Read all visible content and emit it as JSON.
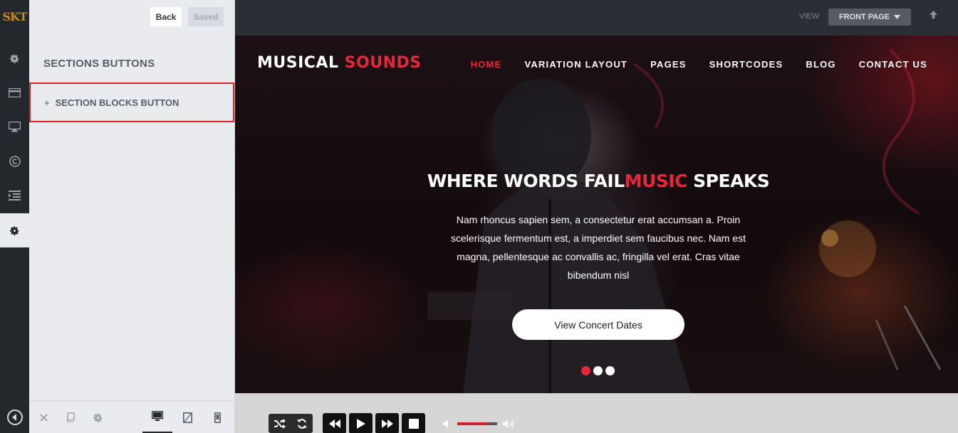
{
  "rail": {
    "logo": "SKT",
    "items": [
      {
        "name": "settings",
        "icon": "gear-icon"
      },
      {
        "name": "card",
        "icon": "credit-card-icon"
      },
      {
        "name": "monitor",
        "icon": "monitor-icon"
      },
      {
        "name": "copyright",
        "icon": "copyright-icon"
      },
      {
        "name": "menu",
        "icon": "indent-list-icon"
      },
      {
        "name": "active-settings",
        "icon": "gear-icon"
      }
    ],
    "collapse_icon": "collapse-left-icon"
  },
  "panel": {
    "back_label": "Back",
    "saved_label": "Saved",
    "title": "SECTIONS BUTTONS",
    "section_item": {
      "prefix": "+",
      "label": "SECTION BLOCKS BUTTON"
    },
    "footer_icons": [
      "close-icon",
      "book-icon",
      "gear-icon"
    ],
    "devices": [
      "desktop-icon",
      "tablet-icon",
      "mobile-icon"
    ],
    "active_device": "desktop"
  },
  "topbar": {
    "view_label": "VIEW",
    "view_value": "FRONT PAGE",
    "up_icon": "arrow-up-icon"
  },
  "site": {
    "logo_primary": "MUSICAL",
    "logo_accent": "SOUNDS",
    "nav": [
      "HOME",
      "VARIATION LAYOUT",
      "PAGES",
      "SHORTCODES",
      "BLOG",
      "CONTACT US"
    ],
    "nav_active": "HOME",
    "headline_part1": "WHERE WORDS FAIL",
    "headline_accent": "MUSIC",
    "headline_part2": " SPEAKS",
    "hero_text": "Nam rhoncus sapien sem, a consectetur erat accumsan a. Proin scelerisque fermentum est, a imperdiet sem faucibus nec. Nam est magna, pellentesque ac convallis ac, fringilla vel erat. Cras vitae bibendum nisl",
    "cta_label": "View Concert Dates",
    "slider_dots": 3,
    "slider_active": 1,
    "accent_color": "#e8263a"
  },
  "player": {
    "controls": [
      "shuffle-icon",
      "repeat-icon",
      "rewind-icon",
      "play-icon",
      "fast-forward-icon",
      "stop-icon"
    ],
    "volume_level": 0.78
  }
}
